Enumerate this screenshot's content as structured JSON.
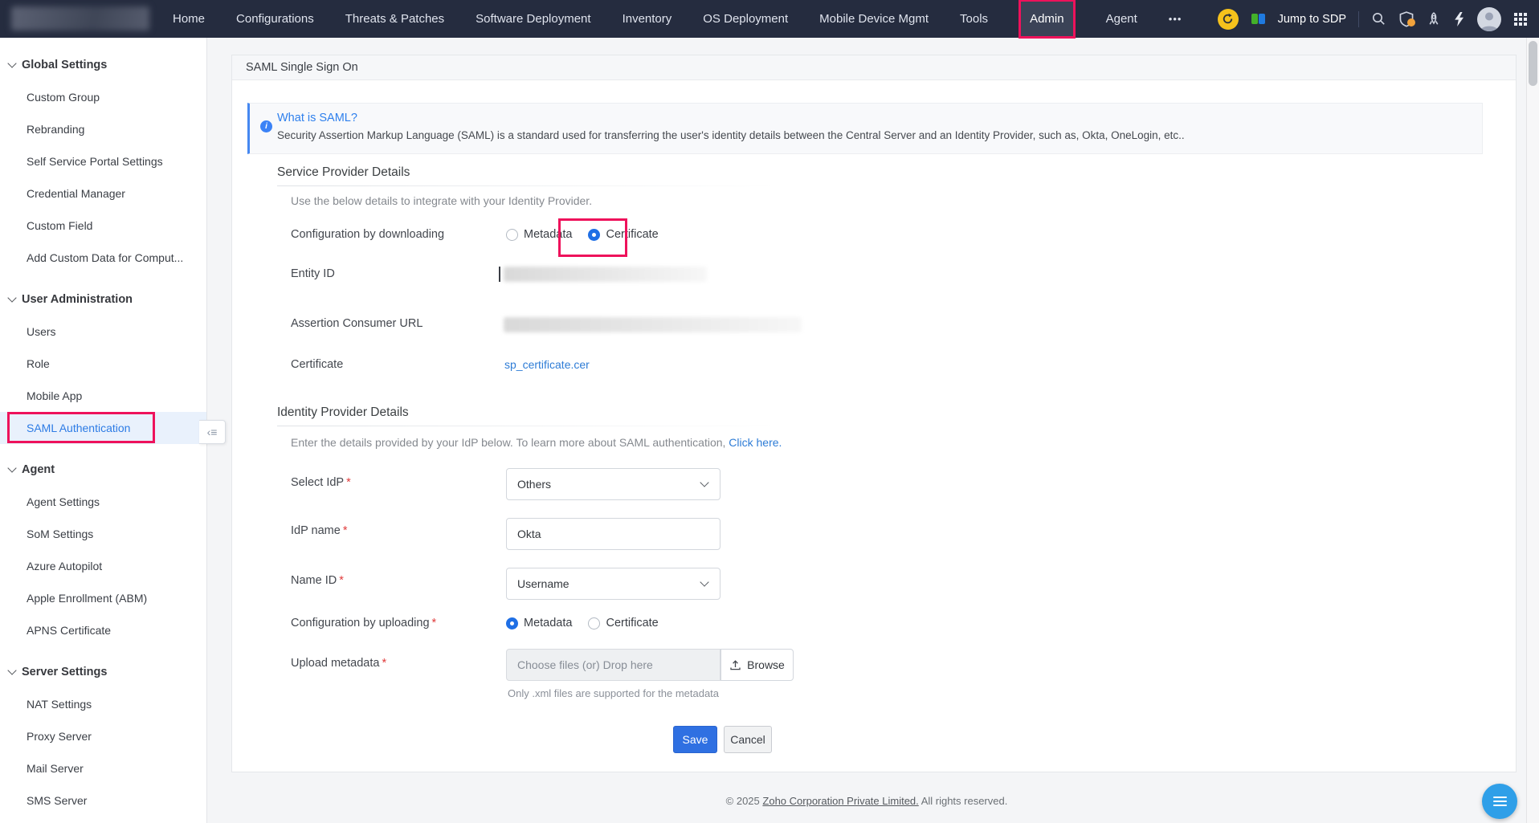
{
  "topnav": {
    "items": [
      "Home",
      "Configurations",
      "Threats & Patches",
      "Software Deployment",
      "Inventory",
      "OS Deployment",
      "Mobile Device Mgmt",
      "Tools",
      "Admin",
      "Agent"
    ],
    "more": "•••",
    "jump_to_sdp": "Jump to SDP"
  },
  "sidebar": {
    "sections": [
      {
        "title": "Global Settings",
        "items": [
          "Custom Group",
          "Rebranding",
          "Self Service Portal Settings",
          "Credential Manager",
          "Custom Field",
          "Add Custom Data for Comput..."
        ]
      },
      {
        "title": "User Administration",
        "items": [
          "Users",
          "Role",
          "Mobile App",
          "SAML Authentication"
        ]
      },
      {
        "title": "Agent",
        "items": [
          "Agent Settings",
          "SoM Settings",
          "Azure Autopilot",
          "Apple Enrollment (ABM)",
          "APNS Certificate"
        ]
      },
      {
        "title": "Server Settings",
        "items": [
          "NAT Settings",
          "Proxy Server",
          "Mail Server",
          "SMS Server"
        ]
      }
    ],
    "active_item": "SAML Authentication"
  },
  "page": {
    "title": "SAML Single Sign On",
    "info": {
      "title": "What is SAML?",
      "desc": "Security Assertion Markup Language (SAML) is a standard used for transferring the user's identity details between the Central Server and an Identity Provider, such as, Okta, OneLogin, etc.."
    },
    "sp": {
      "heading": "Service Provider Details",
      "sub": "Use the below details to integrate with your Identity Provider.",
      "config_label": "Configuration by downloading",
      "metadata": "Metadata",
      "certificate": "Certificate",
      "selected_option": "Certificate",
      "entity_label": "Entity ID",
      "acs_label": "Assertion Consumer URL",
      "cert_label": "Certificate",
      "cert_file": "sp_certificate.cer"
    },
    "idp": {
      "heading": "Identity Provider Details",
      "sub": "Enter the details provided by your IdP below. To learn more about SAML authentication,",
      "sub_link": "Click here.",
      "select_label": "Select IdP",
      "select_value": "Others",
      "name_label": "IdP name",
      "name_value": "Okta",
      "nameid_label": "Name ID",
      "nameid_value": "Username",
      "config_label": "Configuration by uploading",
      "metadata": "Metadata",
      "certificate": "Certificate",
      "selected_option": "Metadata",
      "upload_label": "Upload metadata",
      "upload_placeholder": "Choose files (or) Drop here",
      "browse": "Browse",
      "helper": "Only .xml files are supported for the metadata"
    },
    "actions": {
      "save": "Save",
      "cancel": "Cancel"
    }
  },
  "footer": {
    "prefix": "© 2025",
    "link": "Zoho Corporation Private Limited.",
    "suffix": "All rights reserved."
  },
  "ui": {
    "required": "*",
    "collapse_icon": "‹≡"
  },
  "colors": {
    "annotation_red": "#ee125b",
    "link_blue": "#2e7cd6",
    "save_blue": "#2f70e2",
    "topbar": "#252c3f",
    "radio_blue": "#1f6fe5"
  }
}
